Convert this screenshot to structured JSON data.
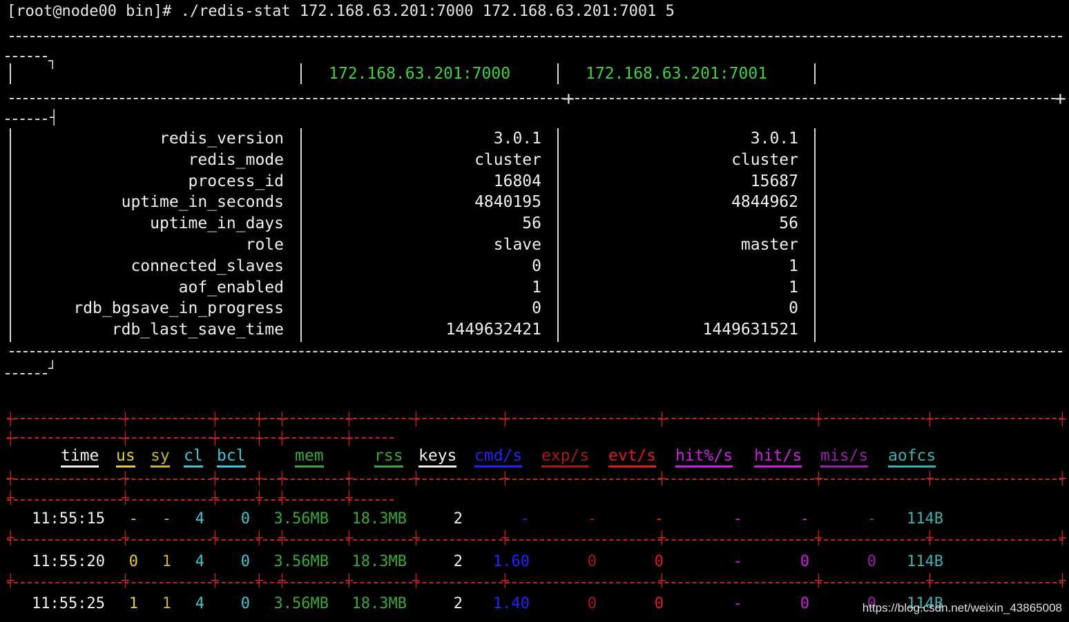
{
  "prompt": "[root@node00 bin]# ./redis-stat 172.168.63.201:7000 172.168.63.201:7001 5",
  "info_table": {
    "servers": [
      "172.168.63.201:7000",
      "172.168.63.201:7001"
    ],
    "rows": [
      {
        "label": "redis_version",
        "values": [
          "3.0.1",
          "3.0.1"
        ]
      },
      {
        "label": "redis_mode",
        "values": [
          "cluster",
          "cluster"
        ]
      },
      {
        "label": "process_id",
        "values": [
          "16804",
          "15687"
        ]
      },
      {
        "label": "uptime_in_seconds",
        "values": [
          "4840195",
          "4844962"
        ]
      },
      {
        "label": "uptime_in_days",
        "values": [
          "56",
          "56"
        ]
      },
      {
        "label": "role",
        "values": [
          "slave",
          "master"
        ]
      },
      {
        "label": "connected_slaves",
        "values": [
          "0",
          "1"
        ]
      },
      {
        "label": "aof_enabled",
        "values": [
          "1",
          "1"
        ]
      },
      {
        "label": "rdb_bgsave_in_progress",
        "values": [
          "0",
          "0"
        ]
      },
      {
        "label": "rdb_last_save_time",
        "values": [
          "1449632421",
          "1449631521"
        ]
      }
    ]
  },
  "stats_table": {
    "columns": [
      {
        "key": "time",
        "label": "time",
        "color": "#f0f0f0"
      },
      {
        "key": "us",
        "label": "us",
        "color": "#e6d12a"
      },
      {
        "key": "sy",
        "label": "sy",
        "color": "#c7b62a"
      },
      {
        "key": "cl",
        "label": "cl",
        "color": "#3fc6d6"
      },
      {
        "key": "bcl",
        "label": "bcl",
        "color": "#3fc6d6"
      },
      {
        "key": "mem",
        "label": "mem",
        "color": "#3aa83a"
      },
      {
        "key": "rss",
        "label": "rss",
        "color": "#3aa83a"
      },
      {
        "key": "keys",
        "label": "keys",
        "color": "#f0f0f0"
      },
      {
        "key": "cmd",
        "label": "cmd/s",
        "color": "#2323ff"
      },
      {
        "key": "exp",
        "label": "exp/s",
        "color": "#a81818"
      },
      {
        "key": "evt",
        "label": "evt/s",
        "color": "#e21a1a"
      },
      {
        "key": "hitpct",
        "label": "hit%/s",
        "color": "#d01ee0"
      },
      {
        "key": "hit",
        "label": "hit/s",
        "color": "#d01ee0"
      },
      {
        "key": "mis",
        "label": "mis/s",
        "color": "#9a1ea8"
      },
      {
        "key": "aofcs",
        "label": "aofcs",
        "color": "#3fb0b0"
      }
    ],
    "rows": [
      [
        "11:55:15",
        "-",
        "-",
        "4",
        "0",
        "3.56MB",
        "18.3MB",
        "2",
        "-",
        "-",
        "-",
        "-",
        "-",
        "-",
        "114B"
      ],
      [
        "11:55:20",
        "0",
        "1",
        "4",
        "0",
        "3.56MB",
        "18.3MB",
        "2",
        "1.60",
        "0",
        "0",
        "-",
        "0",
        "0",
        "114B"
      ],
      [
        "11:55:25",
        "1",
        "1",
        "4",
        "0",
        "3.56MB",
        "18.3MB",
        "2",
        "1.40",
        "0",
        "0",
        "-",
        "0",
        "0",
        "114B"
      ]
    ]
  },
  "watermark": "https://blog.csdn.net/weixin_43865008"
}
